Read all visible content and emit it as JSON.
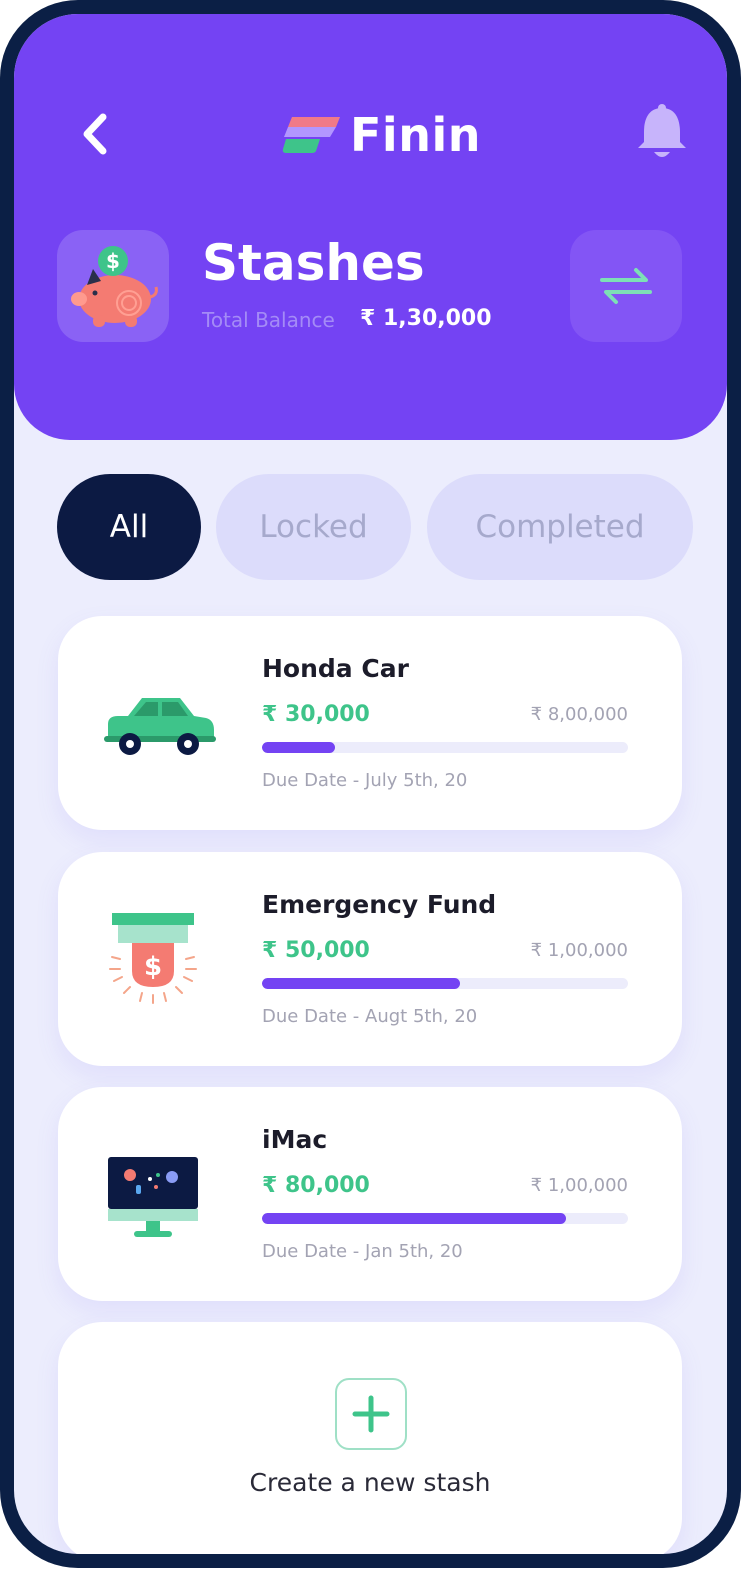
{
  "header": {
    "app_name": "Finin",
    "back_icon": "chevron-left-icon",
    "bell_icon": "bell-icon",
    "title": "Stashes",
    "balance_label": "Total Balance",
    "balance_value": "₹ 1,30,000",
    "swap_icon": "swap-arrows-icon"
  },
  "filters": {
    "all": "All",
    "locked": "Locked",
    "completed": "Completed",
    "selected": "All"
  },
  "stashes": [
    {
      "icon": "car-icon",
      "name": "Honda Car",
      "saved": "₹ 30,000",
      "target": "₹ 8,00,000",
      "progress": 0.2,
      "due": "Due Date - July 5th, 20"
    },
    {
      "icon": "emergency-fund-icon",
      "name": "Emergency Fund",
      "saved": "₹ 50,000",
      "target": "₹ 1,00,000",
      "progress": 0.54,
      "due": "Due Date - Augt 5th, 20"
    },
    {
      "icon": "imac-icon",
      "name": "iMac",
      "saved": "₹ 80,000",
      "target": "₹ 1,00,000",
      "progress": 0.83,
      "due": "Due Date - Jan 5th, 20"
    }
  ],
  "create": {
    "label": "Create a new stash",
    "icon": "plus-icon"
  },
  "colors": {
    "primary": "#7443f3",
    "accent_green": "#3ec48a",
    "dark": "#0c1a43",
    "background": "#ecedfd"
  }
}
